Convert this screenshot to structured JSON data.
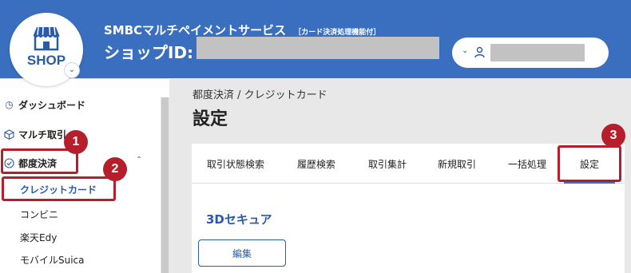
{
  "header": {
    "logo_text": "SHOP",
    "app_title": "SMBCマルチペイメントサービス",
    "app_subtitle": "［カード決済処理機能付］",
    "shop_id_label": "ショップID:"
  },
  "sidebar": {
    "items": [
      {
        "label": "ダッシュボード",
        "icon": "clock-icon"
      },
      {
        "label": "マルチ取引",
        "icon": "cube-icon"
      },
      {
        "label": "都度決済",
        "icon": "check-circle-icon"
      }
    ],
    "sub_items": [
      {
        "label": "クレジットカード",
        "active": true
      },
      {
        "label": "コンビニ",
        "active": false
      },
      {
        "label": "楽天Edy",
        "active": false
      },
      {
        "label": "モバイルSuica",
        "active": false
      }
    ]
  },
  "main": {
    "breadcrumb": "都度決済 / クレジットカード",
    "title": "設定",
    "tabs": [
      {
        "label": "取引状態検索"
      },
      {
        "label": "履歴検索"
      },
      {
        "label": "取引集計"
      },
      {
        "label": "新規取引"
      },
      {
        "label": "一括処理"
      },
      {
        "label": "設定",
        "active": true
      }
    ],
    "section_title": "3Dセキュア",
    "edit_button": "編集"
  },
  "annotations": {
    "badges": [
      "1",
      "2",
      "3"
    ],
    "color": "#b51e2a"
  },
  "colors": {
    "header_bg": "#3a6fbf",
    "accent": "#2a5aa8"
  }
}
